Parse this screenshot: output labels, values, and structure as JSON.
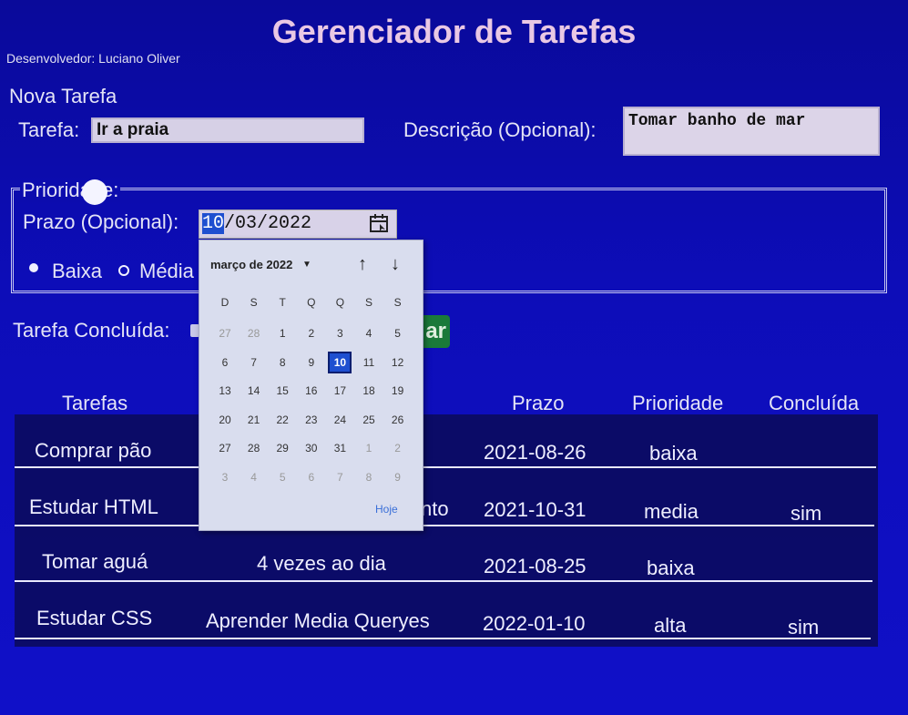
{
  "header": {
    "title": "Gerenciador de Tarefas",
    "developer": "Desenvolvedor: Luciano Oliver"
  },
  "form": {
    "section_title": "Nova Tarefa",
    "task_label": "Tarefa:",
    "task_value": "Ir a praia",
    "description_label": "Descrição (Opcional):",
    "description_value": "Tomar banho de mar",
    "priority_legend": "Prioridade:",
    "deadline_label": "Prazo (Opcional):",
    "deadline_day": "10",
    "deadline_rest": "/03/2022",
    "priority_options": [
      "Baixa",
      "Média"
    ],
    "completed_label": "Tarefa Concluída:",
    "save_button_visible": "ar"
  },
  "calendar": {
    "month_label": "março de 2022",
    "weekdays": [
      "D",
      "S",
      "T",
      "Q",
      "Q",
      "S",
      "S"
    ],
    "weeks": [
      [
        "27",
        "28",
        "1",
        "2",
        "3",
        "4",
        "5"
      ],
      [
        "6",
        "7",
        "8",
        "9",
        "10",
        "11",
        "12"
      ],
      [
        "13",
        "14",
        "15",
        "16",
        "17",
        "18",
        "19"
      ],
      [
        "20",
        "21",
        "22",
        "23",
        "24",
        "25",
        "26"
      ],
      [
        "27",
        "28",
        "29",
        "30",
        "31",
        "1",
        "2"
      ],
      [
        "3",
        "4",
        "5",
        "6",
        "7",
        "8",
        "9"
      ]
    ],
    "selected_day": "10",
    "today_label": "Hoje"
  },
  "table": {
    "headers": [
      "Tarefas",
      "Prazo",
      "Prioridade",
      "Concluída"
    ],
    "rows": [
      {
        "tarefa": "Comprar pão",
        "descricao": "",
        "prazo": "2021-08-26",
        "prioridade": "baixa",
        "concluida": ""
      },
      {
        "tarefa": "Estudar HTML",
        "descricao": "nto",
        "prazo": "2021-10-31",
        "prioridade": "media",
        "concluida": "sim"
      },
      {
        "tarefa": "Tomar aguá",
        "descricao": "4 vezes ao dia",
        "prazo": "2021-08-25",
        "prioridade": "baixa",
        "concluida": ""
      },
      {
        "tarefa": "Estudar CSS",
        "descricao": "Aprender Media Queryes",
        "prazo": "2022-01-10",
        "prioridade": "alta",
        "concluida": "sim"
      }
    ]
  },
  "icons": {
    "calendar": "calendar-icon",
    "month_dropdown": "caret-down-icon",
    "prev": "arrow-up-icon",
    "next": "arrow-down-icon"
  },
  "colors": {
    "background": "#0d0db8",
    "title": "#e9c8e4",
    "selected_date": "#1e4fd0",
    "save_button": "#1a7a3a"
  }
}
